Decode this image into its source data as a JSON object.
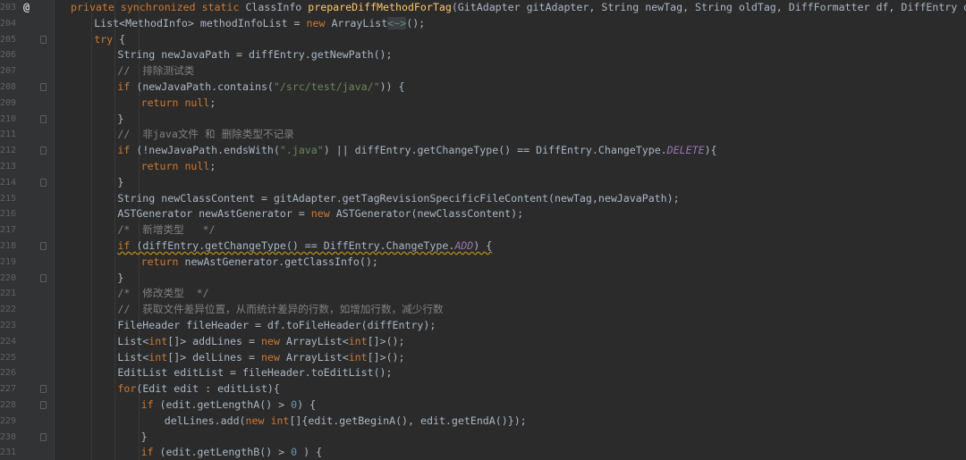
{
  "editor": {
    "language": "Java",
    "override_marker": "@",
    "lines": [
      {
        "no": "203",
        "indent": 0,
        "marker": true,
        "tokens": [
          [
            "kw",
            "private synchronized static "
          ],
          [
            "",
            "ClassInfo "
          ],
          [
            "fn",
            "prepareDiffMethodForTag"
          ],
          [
            "",
            "(GitAdapter gitAdapter, String newTag, String oldTag, DiffFormatter df, DiffEntry diffEntry) {"
          ]
        ]
      },
      {
        "no": "204",
        "indent": 1,
        "tokens": [
          [
            "",
            "List<MethodInfo> methodInfoList = "
          ],
          [
            "kw",
            "new "
          ],
          [
            "",
            "ArrayList"
          ],
          [
            "fold-hint",
            "<~>"
          ],
          [
            "",
            "();"
          ]
        ]
      },
      {
        "no": "205",
        "indent": 1,
        "tokens": [
          [
            "kw",
            "try "
          ],
          [
            "",
            "{"
          ]
        ]
      },
      {
        "no": "206",
        "indent": 2,
        "tokens": [
          [
            "",
            "String newJavaPath = diffEntry.getNewPath();"
          ]
        ]
      },
      {
        "no": "207",
        "indent": 2,
        "tokens": [
          [
            "cm",
            "//  排除测试类"
          ]
        ]
      },
      {
        "no": "208",
        "indent": 2,
        "tokens": [
          [
            "kw",
            "if "
          ],
          [
            "",
            "(newJavaPath.contains("
          ],
          [
            "str",
            "\"/src/test/java/\""
          ],
          [
            "",
            ")) {"
          ]
        ]
      },
      {
        "no": "209",
        "indent": 3,
        "tokens": [
          [
            "kw",
            "return null"
          ],
          [
            "",
            ";"
          ]
        ]
      },
      {
        "no": "210",
        "indent": 2,
        "tokens": [
          [
            "",
            "}"
          ]
        ]
      },
      {
        "no": "211",
        "indent": 2,
        "tokens": [
          [
            "cm",
            "//  非java文件 和 删除类型不记录"
          ]
        ]
      },
      {
        "no": "212",
        "indent": 2,
        "tokens": [
          [
            "kw",
            "if "
          ],
          [
            "",
            "(!newJavaPath.endsWith("
          ],
          [
            "str",
            "\".java\""
          ],
          [
            "",
            ") || diffEntry.getChangeType() == DiffEntry.ChangeType."
          ],
          [
            "cst",
            "DELETE"
          ],
          [
            "",
            "){"
          ]
        ]
      },
      {
        "no": "213",
        "indent": 3,
        "tokens": [
          [
            "kw",
            "return null"
          ],
          [
            "",
            ";"
          ]
        ]
      },
      {
        "no": "214",
        "indent": 2,
        "tokens": [
          [
            "",
            "}"
          ]
        ]
      },
      {
        "no": "215",
        "indent": 2,
        "tokens": [
          [
            "",
            "String newClassContent = gitAdapter.getTagRevisionSpecificFileContent(newTag,newJavaPath);"
          ]
        ]
      },
      {
        "no": "216",
        "indent": 2,
        "tokens": [
          [
            "",
            "ASTGenerator newAstGenerator = "
          ],
          [
            "kw",
            "new "
          ],
          [
            "",
            "ASTGenerator(newClassContent);"
          ]
        ]
      },
      {
        "no": "217",
        "indent": 2,
        "tokens": [
          [
            "cm",
            "/*  新增类型   */"
          ]
        ]
      },
      {
        "no": "218",
        "indent": 2,
        "warn": true,
        "tokens": [
          [
            "kw",
            "if "
          ],
          [
            "",
            "(diffEntry.getChangeType() == DiffEntry.ChangeType."
          ],
          [
            "cst",
            "ADD"
          ],
          [
            "",
            ") {"
          ]
        ]
      },
      {
        "no": "219",
        "indent": 3,
        "tokens": [
          [
            "kw",
            "return "
          ],
          [
            "",
            "newAstGenerator.getClassInfo();"
          ]
        ]
      },
      {
        "no": "220",
        "indent": 2,
        "tokens": [
          [
            "",
            "}"
          ]
        ]
      },
      {
        "no": "221",
        "indent": 2,
        "tokens": [
          [
            "cm",
            "/*  修改类型  */"
          ]
        ]
      },
      {
        "no": "222",
        "indent": 2,
        "tokens": [
          [
            "cm",
            "//  获取文件差异位置，从而统计差异的行数，如增加行数，减少行数"
          ]
        ]
      },
      {
        "no": "223",
        "indent": 2,
        "tokens": [
          [
            "",
            "FileHeader fileHeader = df.toFileHeader(diffEntry);"
          ]
        ]
      },
      {
        "no": "224",
        "indent": 2,
        "tokens": [
          [
            "",
            "List<"
          ],
          [
            "kw",
            "int"
          ],
          [
            "",
            "[]> addLines = "
          ],
          [
            "kw",
            "new "
          ],
          [
            "",
            "ArrayList<"
          ],
          [
            "kw",
            "int"
          ],
          [
            "",
            "[]>();"
          ]
        ]
      },
      {
        "no": "225",
        "indent": 2,
        "tokens": [
          [
            "",
            "List<"
          ],
          [
            "kw",
            "int"
          ],
          [
            "",
            "[]> delLines = "
          ],
          [
            "kw",
            "new "
          ],
          [
            "",
            "ArrayList<"
          ],
          [
            "kw",
            "int"
          ],
          [
            "",
            "[]>();"
          ]
        ]
      },
      {
        "no": "226",
        "indent": 2,
        "tokens": [
          [
            "",
            "EditList editList = fileHeader.toEditList();"
          ]
        ]
      },
      {
        "no": "227",
        "indent": 2,
        "tokens": [
          [
            "kw",
            "for"
          ],
          [
            "",
            "(Edit edit : editList){"
          ]
        ]
      },
      {
        "no": "228",
        "indent": 3,
        "tokens": [
          [
            "kw",
            "if "
          ],
          [
            "",
            "(edit.getLengthA() > "
          ],
          [
            "num",
            "0"
          ],
          [
            "",
            ") {"
          ]
        ]
      },
      {
        "no": "229",
        "indent": 4,
        "tokens": [
          [
            "",
            "delLines.add("
          ],
          [
            "kw",
            "new int"
          ],
          [
            "",
            "[]{edit.getBeginA(), edit.getEndA()});"
          ]
        ]
      },
      {
        "no": "230",
        "indent": 3,
        "tokens": [
          [
            "",
            "}"
          ]
        ]
      },
      {
        "no": "231",
        "indent": 3,
        "tokens": [
          [
            "kw",
            "if "
          ],
          [
            "",
            "(edit.getLengthB() > "
          ],
          [
            "num",
            "0"
          ],
          [
            "",
            " ) {"
          ]
        ]
      }
    ]
  }
}
